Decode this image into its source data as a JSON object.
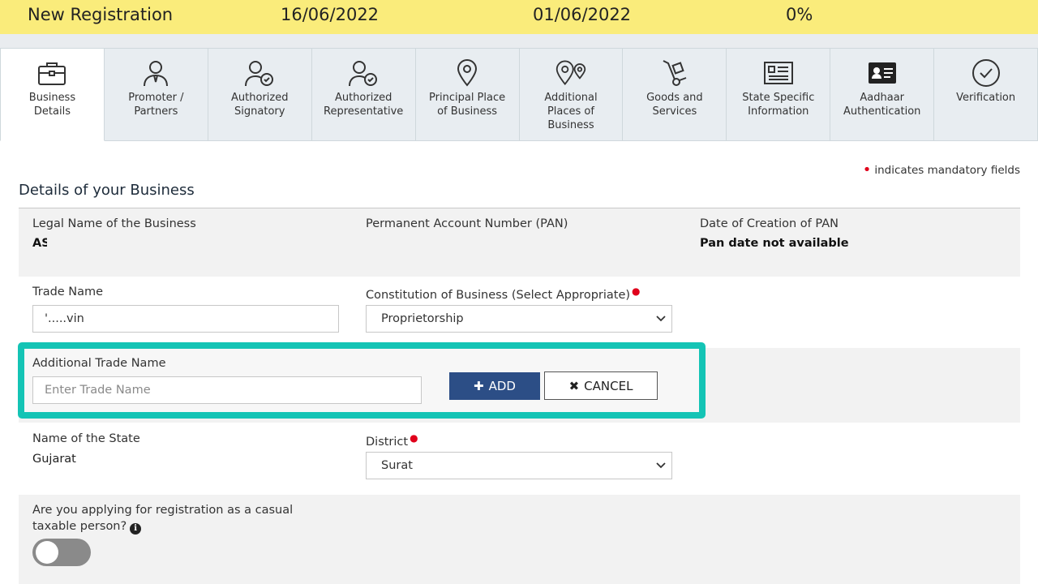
{
  "status_bar": {
    "type": "New Registration",
    "date1": "16/06/2022",
    "date2": "01/06/2022",
    "progress": "0%"
  },
  "tabs": [
    {
      "label": "Business\nDetails",
      "icon": "briefcase-icon",
      "active": true
    },
    {
      "label": "Promoter /\nPartners",
      "icon": "person-tie-icon",
      "active": false
    },
    {
      "label": "Authorized\nSignatory",
      "icon": "person-check-icon",
      "active": false
    },
    {
      "label": "Authorized\nRepresentative",
      "icon": "person-check-icon",
      "active": false
    },
    {
      "label": "Principal Place\nof Business",
      "icon": "map-pin-icon",
      "active": false
    },
    {
      "label": "Additional\nPlaces of\nBusiness",
      "icon": "map-pins-icon",
      "active": false
    },
    {
      "label": "Goods and\nServices",
      "icon": "hand-truck-icon",
      "active": false
    },
    {
      "label": "State Specific\nInformation",
      "icon": "document-list-icon",
      "active": false
    },
    {
      "label": "Aadhaar\nAuthentication",
      "icon": "id-card-icon",
      "active": false
    },
    {
      "label": "Verification",
      "icon": "check-circle-icon",
      "active": false
    }
  ],
  "mandatory_note": "indicates mandatory fields",
  "section_title": "Details of your Business",
  "legal_name": {
    "label": "Legal Name of the Business",
    "value": "AS"
  },
  "pan": {
    "label": "Permanent Account Number (PAN)",
    "value": ""
  },
  "pan_date": {
    "label": "Date of Creation of PAN",
    "value": "Pan date not available"
  },
  "trade_name": {
    "label": "Trade Name",
    "value": "'.....vin"
  },
  "constitution": {
    "label": "Constitution of Business (Select Appropriate)",
    "value": "Proprietorship"
  },
  "additional_trade": {
    "label": "Additional Trade Name",
    "placeholder": "Enter Trade Name",
    "add_label": "ADD",
    "cancel_label": "CANCEL"
  },
  "state": {
    "label": "Name of the State",
    "value": "Gujarat"
  },
  "district": {
    "label": "District",
    "value": "Surat"
  },
  "casual": {
    "label_line1": "Are you applying for registration as a casual",
    "label_line2": "taxable person?",
    "toggle_on": false
  },
  "colors": {
    "accent": "#2c4e86",
    "highlight": "#14c4b5",
    "topbar": "#faec7b",
    "required": "#e0001b"
  }
}
